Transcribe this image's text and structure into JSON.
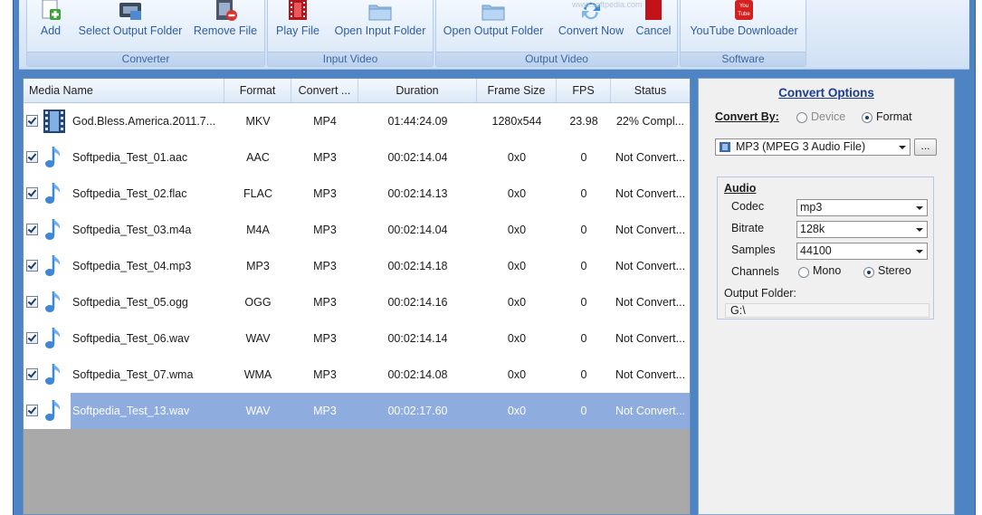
{
  "toolbar": {
    "groups": [
      {
        "title": "Converter",
        "buttons": [
          {
            "label": "Add",
            "icon": "add-file-icon"
          },
          {
            "label": "Select Output Folder",
            "icon": "output-folder-icon"
          },
          {
            "label": "Remove File",
            "icon": "remove-file-icon"
          }
        ]
      },
      {
        "title": "Input Video",
        "buttons": [
          {
            "label": "Play File",
            "icon": "film-play-icon"
          },
          {
            "label": "Open Input Folder",
            "icon": "folder-icon"
          }
        ]
      },
      {
        "title": "Output Video",
        "buttons": [
          {
            "label": "Open Output Folder",
            "icon": "folder-icon"
          },
          {
            "label": "Convert Now",
            "icon": "convert-arrows-icon"
          },
          {
            "label": "Cancel",
            "icon": "cancel-icon"
          }
        ]
      },
      {
        "title": "Software",
        "buttons": [
          {
            "label": "YouTube Downloader",
            "icon": "youtube-icon"
          }
        ]
      }
    ],
    "watermark": "www.softpedia.com"
  },
  "list": {
    "columns": [
      "Media Name",
      "Format",
      "Convert ...",
      "Duration",
      "Frame Size",
      "FPS",
      "Status"
    ],
    "rows": [
      {
        "name": "God.Bless.America.2011.7...",
        "format": "MKV",
        "convert": "MP4",
        "duration": "01:44:24.09",
        "frame": "1280x544",
        "fps": "23.98",
        "status": "22% Compl...",
        "icon": "film-strip-icon",
        "selected": false
      },
      {
        "name": "Softpedia_Test_01.aac",
        "format": "AAC",
        "convert": "MP3",
        "duration": "00:02:14.04",
        "frame": "0x0",
        "fps": "0",
        "status": "Not Convert...",
        "icon": "music-note-icon",
        "selected": false
      },
      {
        "name": "Softpedia_Test_02.flac",
        "format": "FLAC",
        "convert": "MP3",
        "duration": "00:02:14.13",
        "frame": "0x0",
        "fps": "0",
        "status": "Not Convert...",
        "icon": "music-note-icon",
        "selected": false
      },
      {
        "name": "Softpedia_Test_03.m4a",
        "format": "M4A",
        "convert": "MP3",
        "duration": "00:02:14.04",
        "frame": "0x0",
        "fps": "0",
        "status": "Not Convert...",
        "icon": "music-note-icon",
        "selected": false
      },
      {
        "name": "Softpedia_Test_04.mp3",
        "format": "MP3",
        "convert": "MP3",
        "duration": "00:02:14.18",
        "frame": "0x0",
        "fps": "0",
        "status": "Not Convert...",
        "icon": "music-note-icon",
        "selected": false
      },
      {
        "name": "Softpedia_Test_05.ogg",
        "format": "OGG",
        "convert": "MP3",
        "duration": "00:02:14.16",
        "frame": "0x0",
        "fps": "0",
        "status": "Not Convert...",
        "icon": "music-note-icon",
        "selected": false
      },
      {
        "name": "Softpedia_Test_06.wav",
        "format": "WAV",
        "convert": "MP3",
        "duration": "00:02:14.14",
        "frame": "0x0",
        "fps": "0",
        "status": "Not Convert...",
        "icon": "music-note-icon",
        "selected": false
      },
      {
        "name": "Softpedia_Test_07.wma",
        "format": "WMA",
        "convert": "MP3",
        "duration": "00:02:14.08",
        "frame": "0x0",
        "fps": "0",
        "status": "Not Convert...",
        "icon": "music-note-icon",
        "selected": false
      },
      {
        "name": "Softpedia_Test_13.wav",
        "format": "WAV",
        "convert": "MP3",
        "duration": "00:02:17.60",
        "frame": "0x0",
        "fps": "0",
        "status": "Not Convert...",
        "icon": "music-note-icon",
        "selected": true
      }
    ]
  },
  "options": {
    "title": "Convert Options",
    "convert_by_label": "Convert By:",
    "device_label": "Device",
    "format_label": "Format",
    "format_value": "MP3 (MPEG 3 Audio File)",
    "browse_label": "...",
    "audio_label": "Audio",
    "codec_label": "Codec",
    "codec_value": "mp3",
    "bitrate_label": "Bitrate",
    "bitrate_value": "128k",
    "samples_label": "Samples",
    "samples_value": "44100",
    "channels_label": "Channels",
    "mono_label": "Mono",
    "stereo_label": "Stereo",
    "output_folder_label": "Output Folder:",
    "output_folder_value": "G:\\"
  },
  "colors": {
    "frame": "#4f84c4",
    "selected_row": "#8eacdd",
    "title_blue": "#1b3d8f",
    "ribbon_text": "#2f5d9e"
  }
}
